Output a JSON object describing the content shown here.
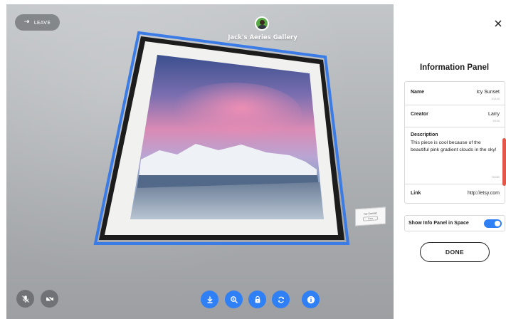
{
  "viewport": {
    "leave_label": "LEAVE",
    "gallery_title": "Jack's Aeries Gallery",
    "plaque": {
      "title": "Icy Sunset",
      "button_label": "View"
    },
    "toolbar_left": [
      {
        "name": "mic-muted-icon"
      },
      {
        "name": "camera-off-icon"
      }
    ],
    "toolbar_center": [
      {
        "name": "download-icon"
      },
      {
        "name": "zoom-icon"
      },
      {
        "name": "lock-icon"
      },
      {
        "name": "refresh-icon"
      },
      {
        "name": "info-icon"
      }
    ]
  },
  "panel": {
    "title": "Information Panel",
    "fields": {
      "name": {
        "label": "Name",
        "value": "Icy Sunset",
        "count": "10/100"
      },
      "creator": {
        "label": "Creator",
        "value": "Larry",
        "count": "5/100"
      },
      "description": {
        "label": "Description",
        "value": "This piece is cool because of the beautiful pink gradient clouds in the sky!",
        "count": "78/280"
      },
      "link": {
        "label": "Link",
        "value": "http://etsy.com"
      }
    },
    "toggle": {
      "label": "Show Info Panel in Space",
      "on": true
    },
    "done_label": "DONE"
  },
  "colors": {
    "accent": "#2f7ff5",
    "scroll": "#e3574b",
    "frame_outline": "#3b7be6"
  }
}
